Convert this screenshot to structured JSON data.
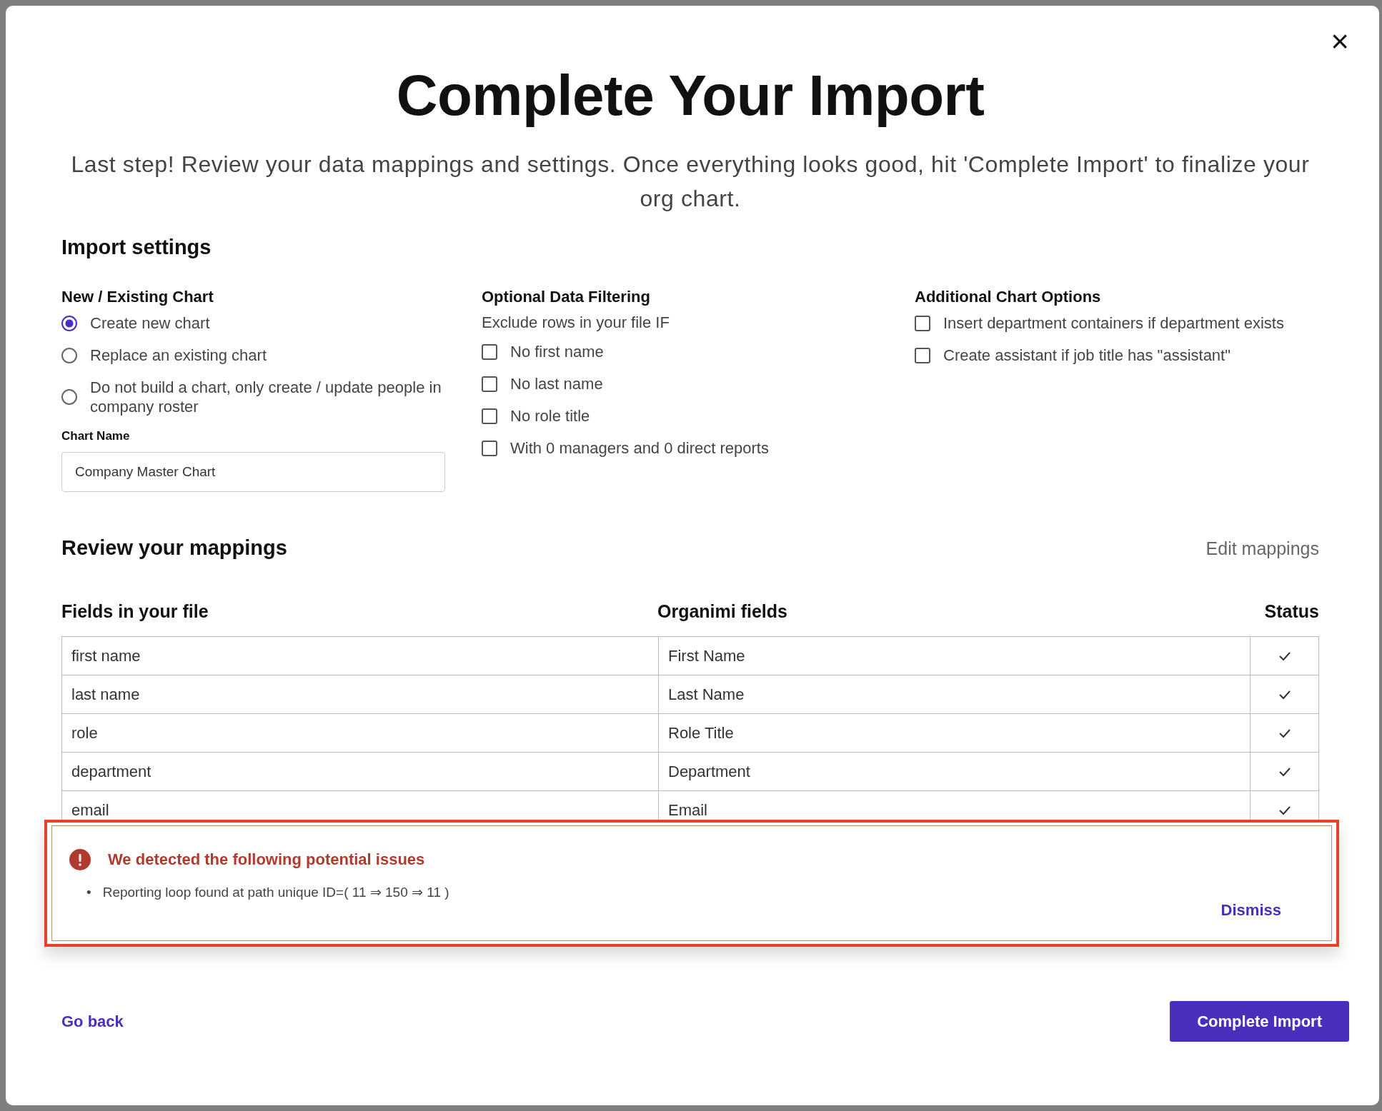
{
  "dialog": {
    "title": "Complete Your Import",
    "subtitle": "Last step! Review your data mappings and settings. Once everything looks good, hit 'Complete Import' to finalize your org chart.",
    "close": "×"
  },
  "import_settings": {
    "heading": "Import settings",
    "chart_mode": {
      "heading": "New / Existing Chart",
      "options": [
        {
          "label": "Create new chart",
          "selected": true
        },
        {
          "label": "Replace an existing chart",
          "selected": false
        },
        {
          "label": "Do not build a chart, only create / update people in company roster",
          "selected": false
        }
      ]
    },
    "chart_name": {
      "label": "Chart Name",
      "value": "Company Master Chart"
    },
    "filtering": {
      "heading": "Optional Data Filtering",
      "hint": "Exclude rows in your file IF",
      "options": [
        {
          "label": "No first name",
          "checked": false
        },
        {
          "label": "No last name",
          "checked": false
        },
        {
          "label": "No role title",
          "checked": false
        },
        {
          "label": "With 0 managers and 0 direct reports",
          "checked": false
        }
      ]
    },
    "chart_options": {
      "heading": "Additional Chart Options",
      "options": [
        {
          "label": "Insert department containers if department exists",
          "checked": false
        },
        {
          "label": "Create assistant if job title has \"assistant\"",
          "checked": false
        }
      ]
    }
  },
  "mappings": {
    "heading": "Review your mappings",
    "edit_link": "Edit mappings",
    "columns": [
      "Fields in your file",
      "Organimi fields",
      "Status"
    ],
    "rows": [
      {
        "file_field": "first name",
        "organimi_field": "First Name",
        "ok": true
      },
      {
        "file_field": "last name",
        "organimi_field": "Last Name",
        "ok": true
      },
      {
        "file_field": "role",
        "organimi_field": "Role Title",
        "ok": true
      },
      {
        "file_field": "department",
        "organimi_field": "Department",
        "ok": true
      },
      {
        "file_field": "email",
        "organimi_field": "Email",
        "ok": true
      }
    ]
  },
  "issues": {
    "title": "We detected the following potential issues",
    "bullet": "•",
    "items": [
      "Reporting loop found at path unique ID=( 11 ⇒ 150 ⇒ 11 )"
    ],
    "dismiss": "Dismiss"
  },
  "footer": {
    "back": "Go back",
    "primary": "Complete Import"
  }
}
